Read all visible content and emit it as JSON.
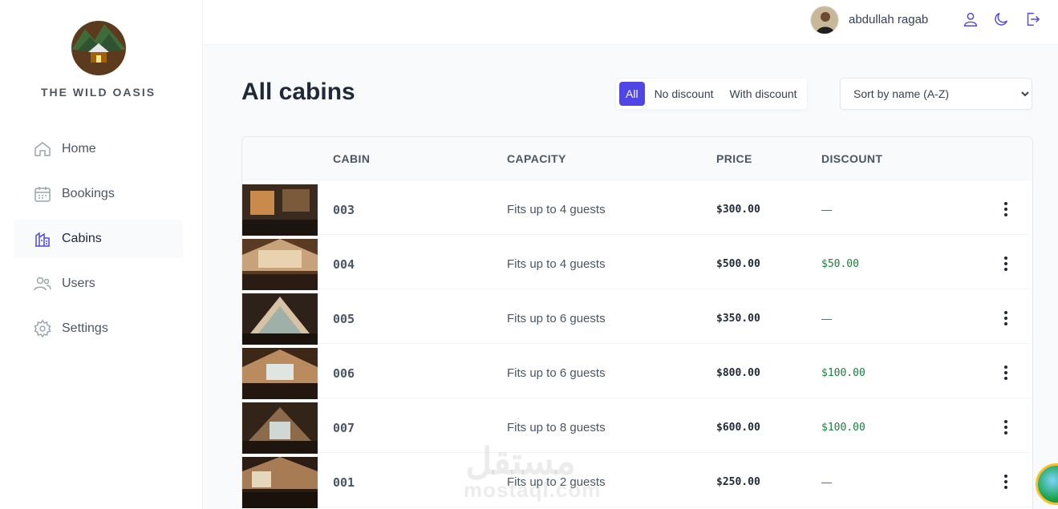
{
  "app": {
    "logo_text": "THE WILD OASIS"
  },
  "sidebar": {
    "items": [
      {
        "label": "Home",
        "icon": "home-icon"
      },
      {
        "label": "Bookings",
        "icon": "calendar-icon"
      },
      {
        "label": "Cabins",
        "icon": "cabin-icon",
        "active": true
      },
      {
        "label": "Users",
        "icon": "users-icon"
      },
      {
        "label": "Settings",
        "icon": "gear-icon"
      }
    ]
  },
  "header": {
    "user_name": "abdullah ragab",
    "icons": [
      "user-icon",
      "moon-icon",
      "logout-icon"
    ]
  },
  "main": {
    "title": "All cabins",
    "filters": [
      "All",
      "No discount",
      "With discount"
    ],
    "active_filter": "All",
    "sort_value": "Sort by name (A-Z)"
  },
  "table": {
    "columns": [
      "CABIN",
      "CAPACITY",
      "PRICE",
      "DISCOUNT"
    ],
    "rows": [
      {
        "name": "003",
        "capacity": "Fits up to 4 guests",
        "price": "$300.00",
        "discount": "—"
      },
      {
        "name": "004",
        "capacity": "Fits up to 4 guests",
        "price": "$500.00",
        "discount": "$50.00"
      },
      {
        "name": "005",
        "capacity": "Fits up to 6 guests",
        "price": "$350.00",
        "discount": "—"
      },
      {
        "name": "006",
        "capacity": "Fits up to 6 guests",
        "price": "$800.00",
        "discount": "$100.00"
      },
      {
        "name": "007",
        "capacity": "Fits up to 8 guests",
        "price": "$600.00",
        "discount": "$100.00"
      },
      {
        "name": "001",
        "capacity": "Fits up to 2 guests",
        "price": "$250.00",
        "discount": "—"
      }
    ]
  },
  "watermark": {
    "arabic": "مستقل",
    "latin": "mostaql.com"
  },
  "colors": {
    "accent": "#4f46e5",
    "discount": "#15803d"
  }
}
